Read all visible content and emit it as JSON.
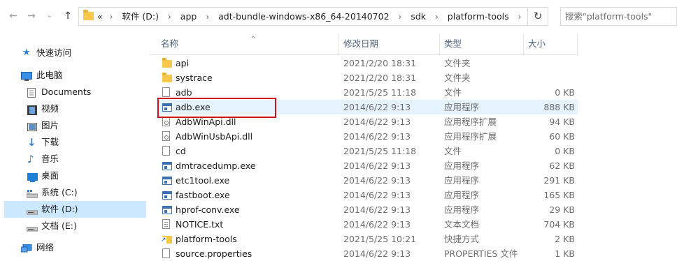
{
  "toolbar": {
    "back_icon": "arrow-left-icon",
    "forward_icon": "arrow-right-icon",
    "recent_icon": "chevron-down-icon",
    "up_icon": "arrow-up-icon"
  },
  "address": {
    "overflow": "«",
    "crumbs": [
      "软件 (D:)",
      "app",
      "adt-bundle-windows-x86_64-20140702",
      "sdk",
      "platform-tools"
    ],
    "separator": "›",
    "dropdown": "⌄",
    "refresh": "↻"
  },
  "search": {
    "placeholder": "搜索\"platform-tools\""
  },
  "sidebar": {
    "items": [
      {
        "label": "快速访问",
        "icon": "star-icon"
      },
      {
        "label": "此电脑",
        "icon": "computer-icon"
      },
      {
        "label": "Documents",
        "icon": "documents-icon"
      },
      {
        "label": "视频",
        "icon": "video-icon"
      },
      {
        "label": "图片",
        "icon": "pictures-icon"
      },
      {
        "label": "下载",
        "icon": "download-icon"
      },
      {
        "label": "音乐",
        "icon": "music-icon"
      },
      {
        "label": "桌面",
        "icon": "desktop-icon"
      },
      {
        "label": "系统 (C:)",
        "icon": "drive-icon"
      },
      {
        "label": "软件 (D:)",
        "icon": "drive-icon",
        "selected": true
      },
      {
        "label": "文档 (E:)",
        "icon": "drive-icon"
      },
      {
        "label": "网络",
        "icon": "network-icon"
      }
    ]
  },
  "columns": {
    "name": "名称",
    "date": "修改日期",
    "type": "类型",
    "size": "大小",
    "sort_indicator": "^"
  },
  "files": [
    {
      "name": "api",
      "date": "2021/2/20 18:31",
      "type": "文件夹",
      "size": "",
      "icon": "folder-icon"
    },
    {
      "name": "systrace",
      "date": "2021/2/20 18:31",
      "type": "文件夹",
      "size": "",
      "icon": "folder-icon"
    },
    {
      "name": "adb",
      "date": "2021/5/25 11:18",
      "type": "文件",
      "size": "0 KB",
      "icon": "file-icon"
    },
    {
      "name": "adb.exe",
      "date": "2014/6/22 9:13",
      "type": "应用程序",
      "size": "888 KB",
      "icon": "exe-icon",
      "highlighted": true
    },
    {
      "name": "AdbWinApi.dll",
      "date": "2014/6/22 9:13",
      "type": "应用程序扩展",
      "size": "94 KB",
      "icon": "dll-icon"
    },
    {
      "name": "AdbWinUsbApi.dll",
      "date": "2014/6/22 9:13",
      "type": "应用程序扩展",
      "size": "60 KB",
      "icon": "dll-icon"
    },
    {
      "name": "cd",
      "date": "2021/5/25 11:18",
      "type": "文件",
      "size": "0 KB",
      "icon": "file-icon"
    },
    {
      "name": "dmtracedump.exe",
      "date": "2014/6/22 9:13",
      "type": "应用程序",
      "size": "62 KB",
      "icon": "exe-icon"
    },
    {
      "name": "etc1tool.exe",
      "date": "2014/6/22 9:13",
      "type": "应用程序",
      "size": "291 KB",
      "icon": "exe-icon"
    },
    {
      "name": "fastboot.exe",
      "date": "2014/6/22 9:13",
      "type": "应用程序",
      "size": "165 KB",
      "icon": "exe-icon"
    },
    {
      "name": "hprof-conv.exe",
      "date": "2014/6/22 9:13",
      "type": "应用程序",
      "size": "29 KB",
      "icon": "exe-icon"
    },
    {
      "name": "NOTICE.txt",
      "date": "2014/6/22 9:13",
      "type": "文本文档",
      "size": "704 KB",
      "icon": "text-file-icon"
    },
    {
      "name": "platform-tools",
      "date": "2021/5/25 10:21",
      "type": "快捷方式",
      "size": "2 KB",
      "icon": "shortcut-icon"
    },
    {
      "name": "source.properties",
      "date": "2014/6/22 9:13",
      "type": "PROPERTIES 文件",
      "size": "1 KB",
      "icon": "file-icon"
    }
  ],
  "colors": {
    "selection": "#cce8ff",
    "hover": "#e5f3ff",
    "annotation": "#d0101a",
    "header_text": "#4c607a"
  }
}
